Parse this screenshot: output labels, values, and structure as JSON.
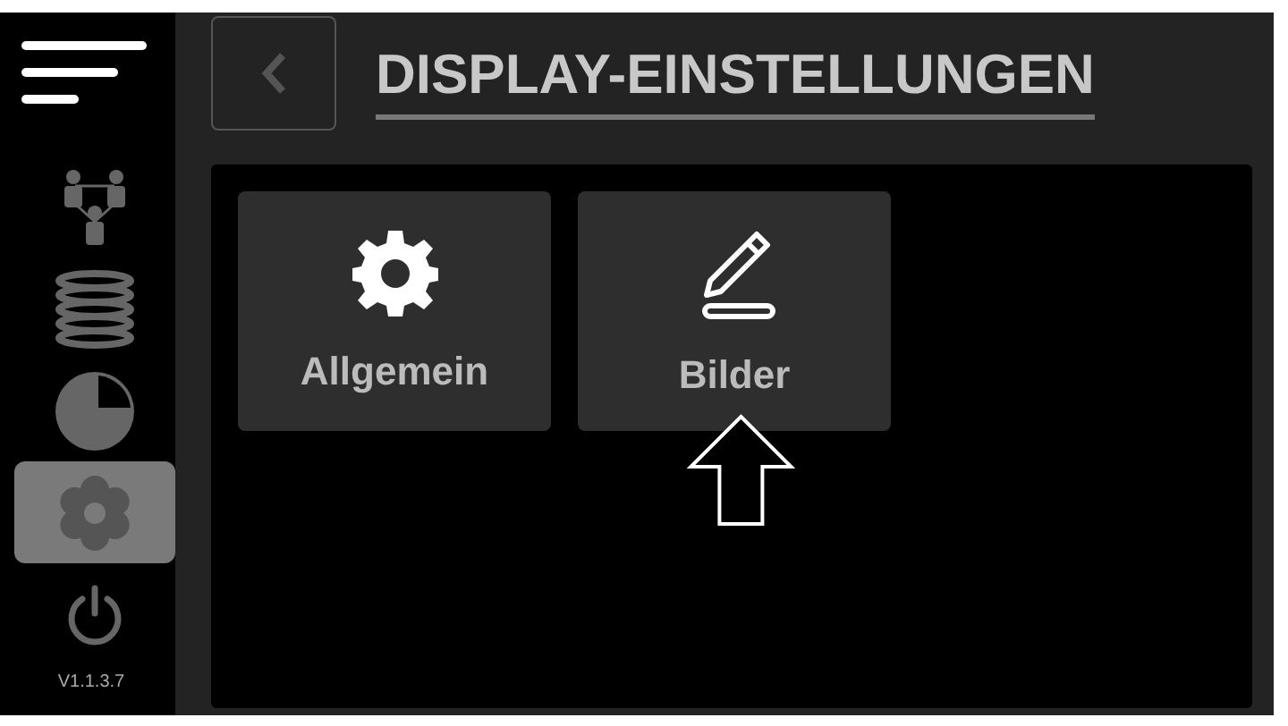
{
  "sidebar": {
    "items": [
      {
        "kind": "menu",
        "selected": false
      },
      {
        "kind": "people",
        "selected": false
      },
      {
        "kind": "database",
        "selected": false
      },
      {
        "kind": "chart",
        "selected": false
      },
      {
        "kind": "settings",
        "selected": true
      },
      {
        "kind": "power",
        "selected": false
      }
    ],
    "version": "V1.1.3.7"
  },
  "header": {
    "title": "DISPLAY-EINSTELLUNGEN"
  },
  "tiles": [
    {
      "kind": "gear",
      "label": "Allgemein",
      "pointed": false
    },
    {
      "kind": "pencil",
      "label": "Bilder",
      "pointed": true
    }
  ]
}
